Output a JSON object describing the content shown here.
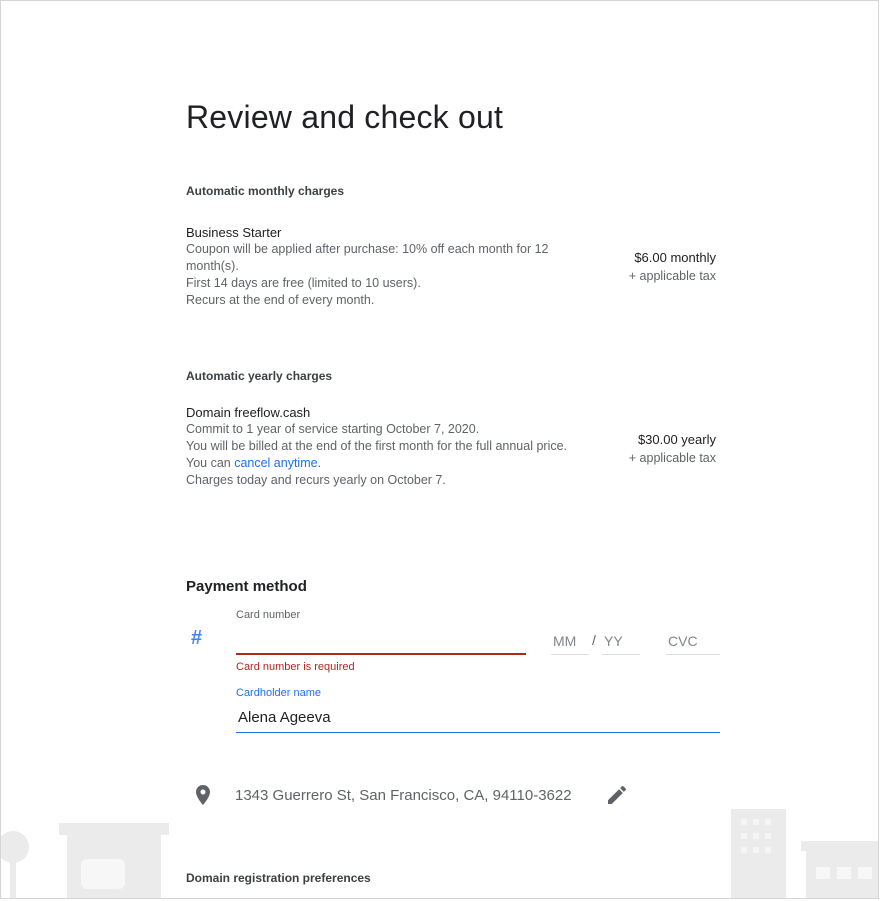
{
  "page": {
    "title": "Review and check out"
  },
  "monthly": {
    "heading": "Automatic monthly charges",
    "plan_name": "Business Starter",
    "line1": "Coupon will be applied after purchase: 10% off each month for 12 month(s).",
    "line2": "First 14 days are free (limited to 10 users).",
    "line3": "Recurs at the end of every month.",
    "price": "$6.00 monthly",
    "tax": "+ applicable tax"
  },
  "yearly": {
    "heading": "Automatic yearly charges",
    "plan_name": "Domain freeflow.cash",
    "line1": "Commit to 1 year of service starting October 7, 2020.",
    "line2_pre": "You will be billed at the end of the first month for the full annual price. You can ",
    "line2_link": "cancel anytime",
    "line2_post": ".",
    "line3": "Charges today and recurs yearly on October 7.",
    "price": "$30.00 yearly",
    "tax": "+ applicable tax"
  },
  "payment": {
    "title": "Payment method",
    "card_icon": "hash-icon",
    "card_label": "Card number",
    "card_value": "",
    "card_error": "Card number is required",
    "mm_placeholder": "MM",
    "slash": "/",
    "yy_placeholder": "YY",
    "cvc_placeholder": "CVC",
    "name_label": "Cardholder name",
    "name_value": "Alena Ageeva"
  },
  "address": {
    "icon": "location-pin-icon",
    "text": "1343 Guerrero St, San Francisco, CA, 94110-3622",
    "edit_icon": "pencil-icon"
  },
  "domain_prefs": {
    "heading": "Domain registration preferences"
  },
  "colors": {
    "accent": "#1a73e8",
    "error": "#b3261e",
    "text": "#202124",
    "muted": "#5f6368"
  }
}
